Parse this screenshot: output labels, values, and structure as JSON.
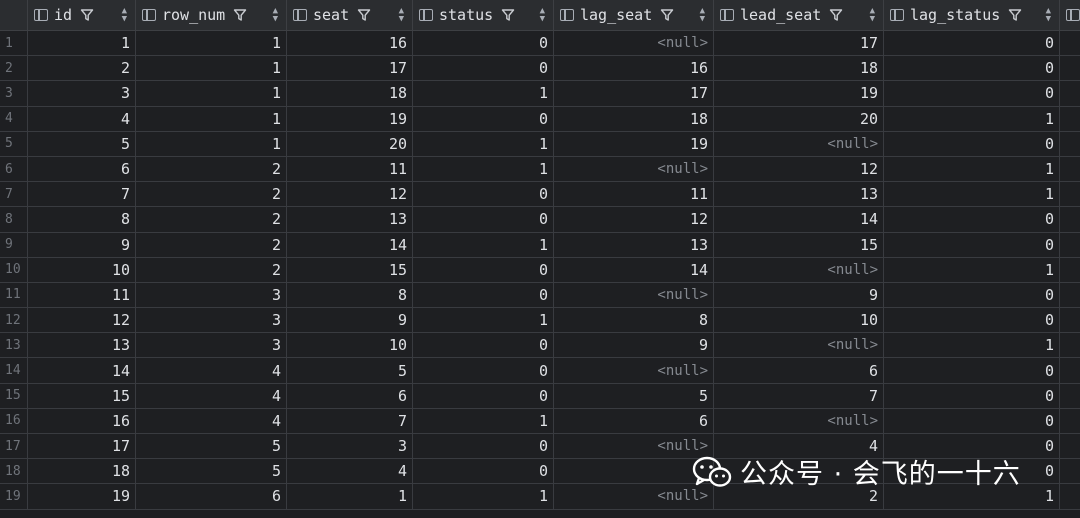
{
  "columns": [
    {
      "label": "id",
      "width": 108
    },
    {
      "label": "row_num",
      "width": 151
    },
    {
      "label": "seat",
      "width": 126
    },
    {
      "label": "status",
      "width": 141
    },
    {
      "label": "lag_seat",
      "width": 160
    },
    {
      "label": "lead_seat",
      "width": 170
    },
    {
      "label": "lag_status",
      "width": 176
    },
    {
      "label": "",
      "width": 60
    }
  ],
  "rows": [
    {
      "n": "1",
      "cells": [
        "1",
        "1",
        "16",
        "0",
        "<null>",
        "17",
        "0",
        ""
      ]
    },
    {
      "n": "2",
      "cells": [
        "2",
        "1",
        "17",
        "0",
        "16",
        "18",
        "0",
        ""
      ]
    },
    {
      "n": "3",
      "cells": [
        "3",
        "1",
        "18",
        "1",
        "17",
        "19",
        "0",
        ""
      ]
    },
    {
      "n": "4",
      "cells": [
        "4",
        "1",
        "19",
        "0",
        "18",
        "20",
        "1",
        ""
      ]
    },
    {
      "n": "5",
      "cells": [
        "5",
        "1",
        "20",
        "1",
        "19",
        "<null>",
        "0",
        ""
      ]
    },
    {
      "n": "6",
      "cells": [
        "6",
        "2",
        "11",
        "1",
        "<null>",
        "12",
        "1",
        ""
      ]
    },
    {
      "n": "7",
      "cells": [
        "7",
        "2",
        "12",
        "0",
        "11",
        "13",
        "1",
        ""
      ]
    },
    {
      "n": "8",
      "cells": [
        "8",
        "2",
        "13",
        "0",
        "12",
        "14",
        "0",
        ""
      ]
    },
    {
      "n": "9",
      "cells": [
        "9",
        "2",
        "14",
        "1",
        "13",
        "15",
        "0",
        ""
      ]
    },
    {
      "n": "10",
      "cells": [
        "10",
        "2",
        "15",
        "0",
        "14",
        "<null>",
        "1",
        ""
      ]
    },
    {
      "n": "11",
      "cells": [
        "11",
        "3",
        "8",
        "0",
        "<null>",
        "9",
        "0",
        ""
      ]
    },
    {
      "n": "12",
      "cells": [
        "12",
        "3",
        "9",
        "1",
        "8",
        "10",
        "0",
        ""
      ]
    },
    {
      "n": "13",
      "cells": [
        "13",
        "3",
        "10",
        "0",
        "9",
        "<null>",
        "1",
        ""
      ]
    },
    {
      "n": "14",
      "cells": [
        "14",
        "4",
        "5",
        "0",
        "<null>",
        "6",
        "0",
        ""
      ]
    },
    {
      "n": "15",
      "cells": [
        "15",
        "4",
        "6",
        "0",
        "5",
        "7",
        "0",
        ""
      ]
    },
    {
      "n": "16",
      "cells": [
        "16",
        "4",
        "7",
        "1",
        "6",
        "<null>",
        "0",
        ""
      ]
    },
    {
      "n": "17",
      "cells": [
        "17",
        "5",
        "3",
        "0",
        "<null>",
        "4",
        "0",
        ""
      ]
    },
    {
      "n": "18",
      "cells": [
        "18",
        "5",
        "4",
        "0",
        "",
        "",
        "0",
        ""
      ]
    },
    {
      "n": "19",
      "cells": [
        "19",
        "6",
        "1",
        "1",
        "<null>",
        "2",
        "1",
        ""
      ]
    }
  ],
  "watermark": {
    "text": "公众号 · 会飞的一十六",
    "icon": "wechat-icon"
  },
  "colors": {
    "background": "#1e1f22",
    "header": "#2b2d30",
    "grid": "#393b40",
    "null_text": "#868a91"
  }
}
